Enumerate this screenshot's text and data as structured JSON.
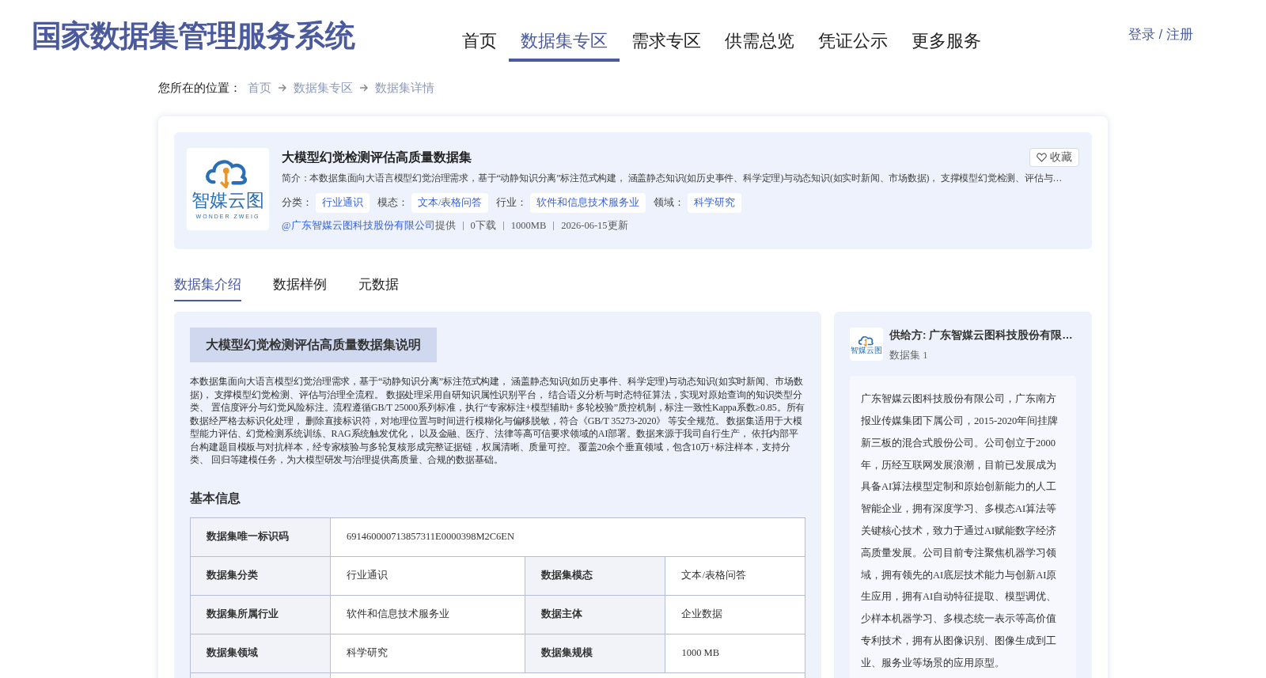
{
  "site_title": "国家数据集管理服务系统",
  "nav": [
    {
      "label": "首页",
      "selected": false
    },
    {
      "label": "数据集专区",
      "selected": true
    },
    {
      "label": "需求专区",
      "selected": false
    },
    {
      "label": "供需总览",
      "selected": false
    },
    {
      "label": "凭证公示",
      "selected": false
    },
    {
      "label": "更多服务",
      "selected": false
    }
  ],
  "login": "登录 / 注册",
  "breadcrumb": {
    "label": "您所在的位置：",
    "items": [
      "首页",
      "数据集专区",
      "数据集详情"
    ]
  },
  "dataset": {
    "logo_text": "智媒云图",
    "logo_subtext": "WONDER ZWEIG",
    "title": "大模型幻觉检测评估高质量数据集",
    "favorite": "收藏",
    "summary": "简介：本数据集面向大语言模型幻觉治理需求，基于“动静知识分离”标注范式构建， 涵盖静态知识(如历史事件、科学定理)与动态知识(如实时新闻、市场数据)， 支撑模型幻觉检测、评估与…",
    "tags": [
      {
        "label": "分类：",
        "value": "行业通识"
      },
      {
        "label": "模态：",
        "value": "文本/表格问答"
      },
      {
        "label": "行业：",
        "value": "软件和信息技术服务业"
      },
      {
        "label": "领域：",
        "value": "科学研究"
      }
    ],
    "provider": "@广东智媒云图科技股份有限公司",
    "provider_suffix": "提供",
    "meta": [
      "0下载",
      "1000MB",
      "2026-06-15更新"
    ]
  },
  "tabs": [
    {
      "label": "数据集介绍",
      "selected": true
    },
    {
      "label": "数据样例",
      "selected": false
    },
    {
      "label": "元数据",
      "selected": false
    }
  ],
  "intro": {
    "heading": "大模型幻觉检测评估高质量数据集说明",
    "text": "本数据集面向大语言模型幻觉治理需求，基于“动静知识分离”标注范式构建， 涵盖静态知识(如历史事件、科学定理)与动态知识(如实时新闻、市场数据)， 支撑模型幻觉检测、评估与治理全流程。 数据处理采用自研知识属性识别平台， 结合语义分析与时态特征算法，实现对原始查询的知识类型分类、 置信度评分与幻觉风险标注。流程遵循GB/T 25000系列标准，执行“专家标注+模型辅助+ 多轮校验”质控机制，标注一致性Kappa系数≥0.85。所有数据经严格去标识化处理， 删除直接标识符，对地理位置与时间进行模糊化与偏移脱敏，符合《GB/T 35273-2020》 等安全规范。 数据集适用于大模型能力评估、幻觉检测系统训练、RAG系统触发优化， 以及金融、医疗、法律等高可信要求领域的AI部署。数据来源于我司自行生产， 依托内部平台构建题目模板与对抗样本，经专家核验与多轮复核形成完整证据链，权属清晰、质量可控。 覆盖20余个垂直领域，包含10万+标注样本，支持分类、 回归等建模任务，为大模型研发与治理提供高质量、合规的数据基础。"
  },
  "basic_info": {
    "heading": "基本信息",
    "rows": [
      [
        {
          "label": "数据集唯一标识码",
          "value": "691460000713857311E0000398M2C6EN"
        }
      ],
      [
        {
          "label": "数据集分类",
          "value": "行业通识"
        },
        {
          "label": "数据集模态",
          "value": "文本/表格问答"
        }
      ],
      [
        {
          "label": "数据集所属行业",
          "value": "软件和信息技术服务业"
        },
        {
          "label": "数据主体",
          "value": "企业数据"
        }
      ],
      [
        {
          "label": "数据集领域",
          "value": "科学研究"
        },
        {
          "label": "数据集规模",
          "value": "1000 MB"
        }
      ]
    ]
  },
  "supplier": {
    "logo_text": "智媒云图",
    "name": "供给方: 广东智媒云图科技股份有限…",
    "count": "数据集 1",
    "description": "广东智媒云图科技股份有限公司，广东南方报业传媒集团下属公司，2015-2020年间挂牌新三板的混合式股份公司。公司创立于2000年，历经互联网发展浪潮，目前已发展成为具备AI算法模型定制和原始创新能力的人工智能企业，拥有深度学习、多模态AI算法等关键核心技术，致力于通过AI赋能数字经济高质量发展。公司目前专注聚焦机器学习领域，拥有领先的AI底层技术能力与创新AI原生应用，拥有AI自动特征提取、模型调优、少样本机器学习、多模态统一表示等高价值专利技术，拥有从图像识别、图像生成到工业、服务业等场景的应用原型。"
  }
}
